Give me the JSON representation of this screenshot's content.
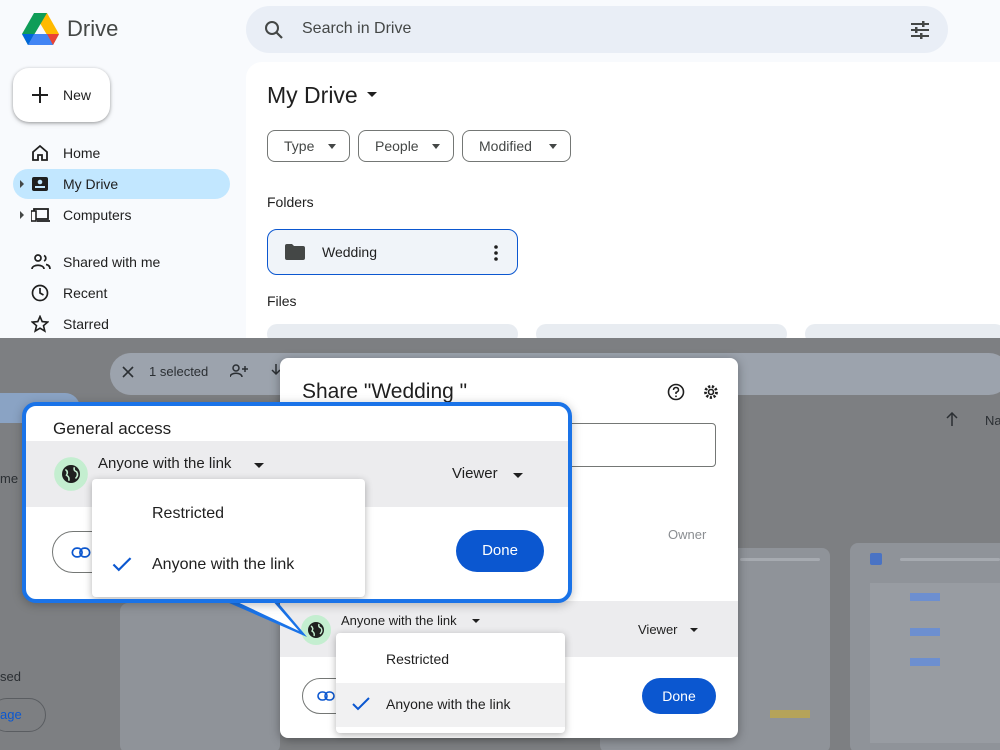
{
  "app": {
    "name": "Drive",
    "search_placeholder": "Search in Drive",
    "new_label": "New"
  },
  "sidebar": {
    "items": [
      {
        "label": "Home",
        "icon": "home-icon"
      },
      {
        "label": "My Drive",
        "icon": "my-drive-icon",
        "active": true
      },
      {
        "label": "Computers",
        "icon": "computers-icon"
      },
      {
        "label": "Shared with me",
        "icon": "shared-icon"
      },
      {
        "label": "Recent",
        "icon": "clock-icon"
      },
      {
        "label": "Starred",
        "icon": "star-icon"
      }
    ]
  },
  "main": {
    "title": "My Drive",
    "filters": [
      "Type",
      "People",
      "Modified"
    ],
    "folders_label": "Folders",
    "files_label": "Files",
    "folder": {
      "name": "Wedding"
    }
  },
  "background": {
    "selection_text": "1 selected",
    "left_fragments": [
      "me",
      "sed",
      "age"
    ],
    "sort_label": "Na"
  },
  "share_dialog": {
    "title": "Share \"Wedding \"",
    "owner_label": "Owner",
    "access": "Anyone with the link",
    "role": "Viewer",
    "done_label": "Done",
    "menu_options": [
      "Restricted",
      "Anyone with the link"
    ],
    "selected_option": "Anyone with the link"
  },
  "callout": {
    "heading": "General access",
    "access": "Anyone with the link",
    "role": "Viewer",
    "done_label": "Done",
    "menu_options": [
      "Restricted",
      "Anyone with the link"
    ]
  },
  "colors": {
    "accent": "#0b57d0",
    "callout_border": "#1a73e8",
    "active_nav": "#c2e7ff",
    "globe_bg": "#c4eed0"
  }
}
